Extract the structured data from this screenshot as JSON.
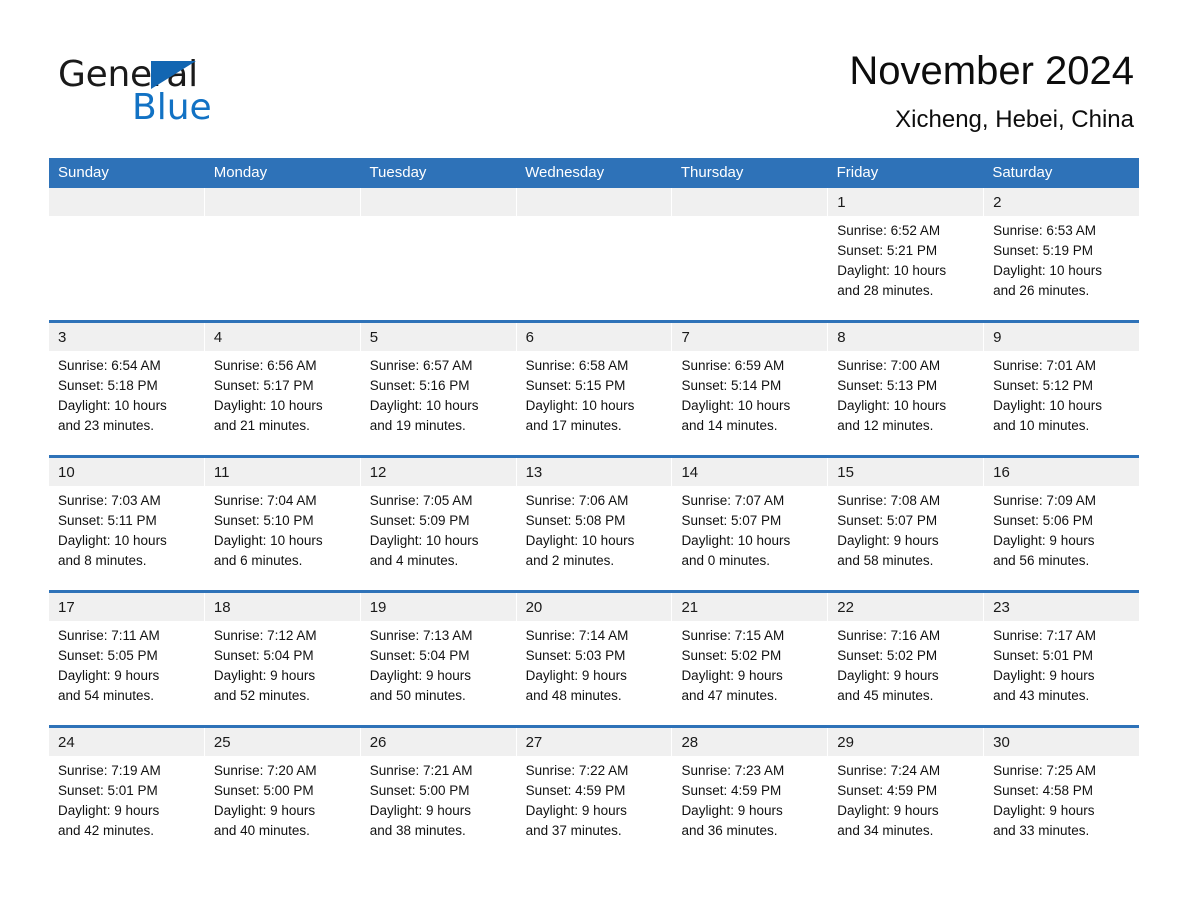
{
  "brand": {
    "word_one": "General",
    "word_two": "Blue",
    "triangle_color": "#1266b2",
    "blue_color": "#1272c4"
  },
  "header": {
    "month_title": "November 2024",
    "location": "Xicheng, Hebei, China"
  },
  "theme": {
    "header_blue": "#2e72b8",
    "day_strip_gray": "#f0f0f0",
    "cell_white": "#ffffff"
  },
  "weekdays": [
    "Sunday",
    "Monday",
    "Tuesday",
    "Wednesday",
    "Thursday",
    "Friday",
    "Saturday"
  ],
  "weeks": [
    [
      {
        "day": "",
        "sunrise": "",
        "sunset": "",
        "daylight_line1": "",
        "daylight_line2": ""
      },
      {
        "day": "",
        "sunrise": "",
        "sunset": "",
        "daylight_line1": "",
        "daylight_line2": ""
      },
      {
        "day": "",
        "sunrise": "",
        "sunset": "",
        "daylight_line1": "",
        "daylight_line2": ""
      },
      {
        "day": "",
        "sunrise": "",
        "sunset": "",
        "daylight_line1": "",
        "daylight_line2": ""
      },
      {
        "day": "",
        "sunrise": "",
        "sunset": "",
        "daylight_line1": "",
        "daylight_line2": ""
      },
      {
        "day": "1",
        "sunrise": "Sunrise: 6:52 AM",
        "sunset": "Sunset: 5:21 PM",
        "daylight_line1": "Daylight: 10 hours",
        "daylight_line2": "and 28 minutes."
      },
      {
        "day": "2",
        "sunrise": "Sunrise: 6:53 AM",
        "sunset": "Sunset: 5:19 PM",
        "daylight_line1": "Daylight: 10 hours",
        "daylight_line2": "and 26 minutes."
      }
    ],
    [
      {
        "day": "3",
        "sunrise": "Sunrise: 6:54 AM",
        "sunset": "Sunset: 5:18 PM",
        "daylight_line1": "Daylight: 10 hours",
        "daylight_line2": "and 23 minutes."
      },
      {
        "day": "4",
        "sunrise": "Sunrise: 6:56 AM",
        "sunset": "Sunset: 5:17 PM",
        "daylight_line1": "Daylight: 10 hours",
        "daylight_line2": "and 21 minutes."
      },
      {
        "day": "5",
        "sunrise": "Sunrise: 6:57 AM",
        "sunset": "Sunset: 5:16 PM",
        "daylight_line1": "Daylight: 10 hours",
        "daylight_line2": "and 19 minutes."
      },
      {
        "day": "6",
        "sunrise": "Sunrise: 6:58 AM",
        "sunset": "Sunset: 5:15 PM",
        "daylight_line1": "Daylight: 10 hours",
        "daylight_line2": "and 17 minutes."
      },
      {
        "day": "7",
        "sunrise": "Sunrise: 6:59 AM",
        "sunset": "Sunset: 5:14 PM",
        "daylight_line1": "Daylight: 10 hours",
        "daylight_line2": "and 14 minutes."
      },
      {
        "day": "8",
        "sunrise": "Sunrise: 7:00 AM",
        "sunset": "Sunset: 5:13 PM",
        "daylight_line1": "Daylight: 10 hours",
        "daylight_line2": "and 12 minutes."
      },
      {
        "day": "9",
        "sunrise": "Sunrise: 7:01 AM",
        "sunset": "Sunset: 5:12 PM",
        "daylight_line1": "Daylight: 10 hours",
        "daylight_line2": "and 10 minutes."
      }
    ],
    [
      {
        "day": "10",
        "sunrise": "Sunrise: 7:03 AM",
        "sunset": "Sunset: 5:11 PM",
        "daylight_line1": "Daylight: 10 hours",
        "daylight_line2": "and 8 minutes."
      },
      {
        "day": "11",
        "sunrise": "Sunrise: 7:04 AM",
        "sunset": "Sunset: 5:10 PM",
        "daylight_line1": "Daylight: 10 hours",
        "daylight_line2": "and 6 minutes."
      },
      {
        "day": "12",
        "sunrise": "Sunrise: 7:05 AM",
        "sunset": "Sunset: 5:09 PM",
        "daylight_line1": "Daylight: 10 hours",
        "daylight_line2": "and 4 minutes."
      },
      {
        "day": "13",
        "sunrise": "Sunrise: 7:06 AM",
        "sunset": "Sunset: 5:08 PM",
        "daylight_line1": "Daylight: 10 hours",
        "daylight_line2": "and 2 minutes."
      },
      {
        "day": "14",
        "sunrise": "Sunrise: 7:07 AM",
        "sunset": "Sunset: 5:07 PM",
        "daylight_line1": "Daylight: 10 hours",
        "daylight_line2": "and 0 minutes."
      },
      {
        "day": "15",
        "sunrise": "Sunrise: 7:08 AM",
        "sunset": "Sunset: 5:07 PM",
        "daylight_line1": "Daylight: 9 hours",
        "daylight_line2": "and 58 minutes."
      },
      {
        "day": "16",
        "sunrise": "Sunrise: 7:09 AM",
        "sunset": "Sunset: 5:06 PM",
        "daylight_line1": "Daylight: 9 hours",
        "daylight_line2": "and 56 minutes."
      }
    ],
    [
      {
        "day": "17",
        "sunrise": "Sunrise: 7:11 AM",
        "sunset": "Sunset: 5:05 PM",
        "daylight_line1": "Daylight: 9 hours",
        "daylight_line2": "and 54 minutes."
      },
      {
        "day": "18",
        "sunrise": "Sunrise: 7:12 AM",
        "sunset": "Sunset: 5:04 PM",
        "daylight_line1": "Daylight: 9 hours",
        "daylight_line2": "and 52 minutes."
      },
      {
        "day": "19",
        "sunrise": "Sunrise: 7:13 AM",
        "sunset": "Sunset: 5:04 PM",
        "daylight_line1": "Daylight: 9 hours",
        "daylight_line2": "and 50 minutes."
      },
      {
        "day": "20",
        "sunrise": "Sunrise: 7:14 AM",
        "sunset": "Sunset: 5:03 PM",
        "daylight_line1": "Daylight: 9 hours",
        "daylight_line2": "and 48 minutes."
      },
      {
        "day": "21",
        "sunrise": "Sunrise: 7:15 AM",
        "sunset": "Sunset: 5:02 PM",
        "daylight_line1": "Daylight: 9 hours",
        "daylight_line2": "and 47 minutes."
      },
      {
        "day": "22",
        "sunrise": "Sunrise: 7:16 AM",
        "sunset": "Sunset: 5:02 PM",
        "daylight_line1": "Daylight: 9 hours",
        "daylight_line2": "and 45 minutes."
      },
      {
        "day": "23",
        "sunrise": "Sunrise: 7:17 AM",
        "sunset": "Sunset: 5:01 PM",
        "daylight_line1": "Daylight: 9 hours",
        "daylight_line2": "and 43 minutes."
      }
    ],
    [
      {
        "day": "24",
        "sunrise": "Sunrise: 7:19 AM",
        "sunset": "Sunset: 5:01 PM",
        "daylight_line1": "Daylight: 9 hours",
        "daylight_line2": "and 42 minutes."
      },
      {
        "day": "25",
        "sunrise": "Sunrise: 7:20 AM",
        "sunset": "Sunset: 5:00 PM",
        "daylight_line1": "Daylight: 9 hours",
        "daylight_line2": "and 40 minutes."
      },
      {
        "day": "26",
        "sunrise": "Sunrise: 7:21 AM",
        "sunset": "Sunset: 5:00 PM",
        "daylight_line1": "Daylight: 9 hours",
        "daylight_line2": "and 38 minutes."
      },
      {
        "day": "27",
        "sunrise": "Sunrise: 7:22 AM",
        "sunset": "Sunset: 4:59 PM",
        "daylight_line1": "Daylight: 9 hours",
        "daylight_line2": "and 37 minutes."
      },
      {
        "day": "28",
        "sunrise": "Sunrise: 7:23 AM",
        "sunset": "Sunset: 4:59 PM",
        "daylight_line1": "Daylight: 9 hours",
        "daylight_line2": "and 36 minutes."
      },
      {
        "day": "29",
        "sunrise": "Sunrise: 7:24 AM",
        "sunset": "Sunset: 4:59 PM",
        "daylight_line1": "Daylight: 9 hours",
        "daylight_line2": "and 34 minutes."
      },
      {
        "day": "30",
        "sunrise": "Sunrise: 7:25 AM",
        "sunset": "Sunset: 4:58 PM",
        "daylight_line1": "Daylight: 9 hours",
        "daylight_line2": "and 33 minutes."
      }
    ]
  ]
}
